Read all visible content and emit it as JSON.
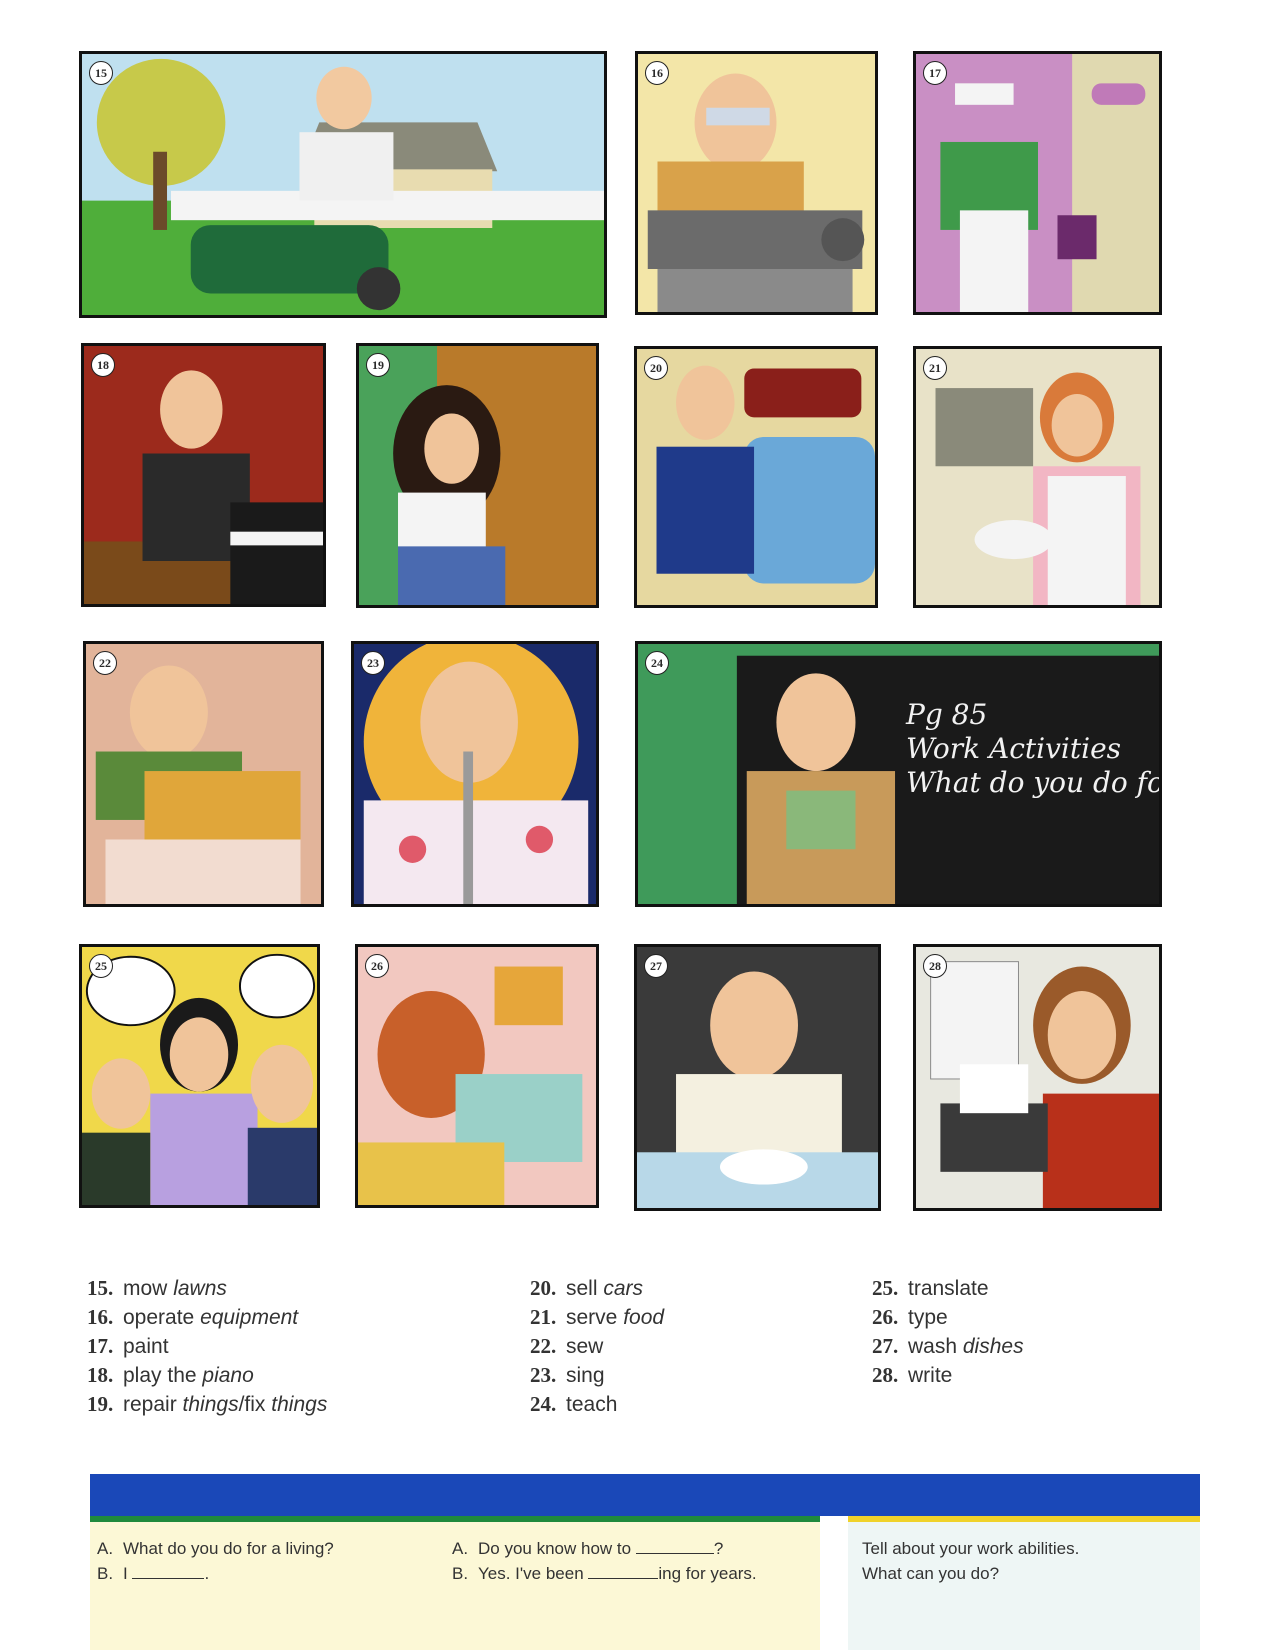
{
  "panels": [
    {
      "num": "15"
    },
    {
      "num": "16"
    },
    {
      "num": "17"
    },
    {
      "num": "18"
    },
    {
      "num": "19"
    },
    {
      "num": "20"
    },
    {
      "num": "21"
    },
    {
      "num": "22"
    },
    {
      "num": "23"
    },
    {
      "num": "24"
    },
    {
      "num": "25"
    },
    {
      "num": "26"
    },
    {
      "num": "27"
    },
    {
      "num": "28"
    }
  ],
  "chalkboard": {
    "line1": "Pg 85",
    "line2": "Work Activities",
    "line3": "What do you do for a li"
  },
  "vocab": [
    {
      "n": "15.",
      "verb": "mow",
      "obj": "lawns"
    },
    {
      "n": "16.",
      "verb": "operate",
      "obj": "equipment"
    },
    {
      "n": "17.",
      "verb": "paint",
      "obj": ""
    },
    {
      "n": "18.",
      "verb": "play the",
      "obj": "piano"
    },
    {
      "n": "19.",
      "verb": "repair",
      "obj": "things",
      "mid": "/fix",
      "obj2": "things"
    },
    {
      "n": "20.",
      "verb": "sell",
      "obj": "cars"
    },
    {
      "n": "21.",
      "verb": "serve",
      "obj": "food"
    },
    {
      "n": "22.",
      "verb": "sew",
      "obj": ""
    },
    {
      "n": "23.",
      "verb": "sing",
      "obj": ""
    },
    {
      "n": "24.",
      "verb": "teach",
      "obj": ""
    },
    {
      "n": "25.",
      "verb": "translate",
      "obj": ""
    },
    {
      "n": "26.",
      "verb": "type",
      "obj": ""
    },
    {
      "n": "27.",
      "verb": "wash",
      "obj": "dishes"
    },
    {
      "n": "28.",
      "verb": "write",
      "obj": ""
    }
  ],
  "conversation1": {
    "a_label": "A.",
    "a_text": "What do you do for a living?",
    "b_label": "B.",
    "b_text": "I",
    "b_end": "."
  },
  "conversation2": {
    "a_label": "A.",
    "a_text": "Do you know how to",
    "a_end": "?",
    "b_label": "B.",
    "b_text": "Yes.  I've been",
    "b_end": "ing for years."
  },
  "tell": {
    "line1": "Tell about your work abilities.",
    "line2": "What can you do?"
  },
  "colors": {
    "band_blue": "#1a48b8",
    "band_green": "#1f8a3c",
    "band_yellow": "#f0d22a",
    "conv_bg": "#fcf8d6",
    "tell_bg": "#eef6f5"
  }
}
